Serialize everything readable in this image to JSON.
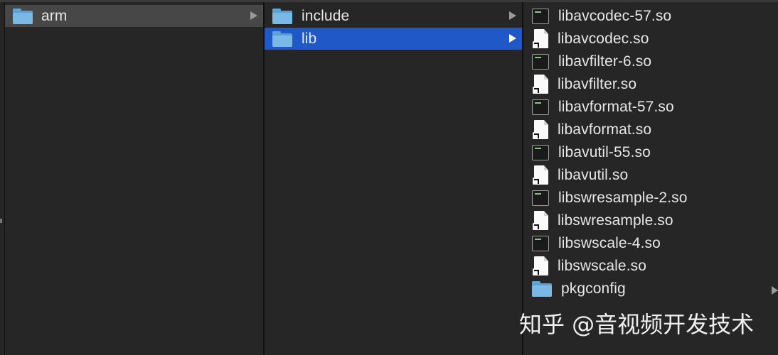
{
  "columns": {
    "col1": {
      "items": [
        {
          "label": "arm",
          "kind": "folder",
          "state": "parent-of-selection",
          "has_children": true
        }
      ]
    },
    "col2": {
      "items": [
        {
          "label": "include",
          "kind": "folder",
          "state": "normal",
          "has_children": true
        },
        {
          "label": "lib",
          "kind": "folder",
          "state": "selected",
          "has_children": true
        }
      ]
    },
    "col3": {
      "items": [
        {
          "label": "libavcodec-57.so",
          "kind": "executable"
        },
        {
          "label": "libavcodec.so",
          "kind": "alias"
        },
        {
          "label": "libavfilter-6.so",
          "kind": "executable"
        },
        {
          "label": "libavfilter.so",
          "kind": "alias"
        },
        {
          "label": "libavformat-57.so",
          "kind": "executable"
        },
        {
          "label": "libavformat.so",
          "kind": "alias"
        },
        {
          "label": "libavutil-55.so",
          "kind": "executable"
        },
        {
          "label": "libavutil.so",
          "kind": "alias"
        },
        {
          "label": "libswresample-2.so",
          "kind": "executable"
        },
        {
          "label": "libswresample.so",
          "kind": "alias"
        },
        {
          "label": "libswscale-4.so",
          "kind": "executable"
        },
        {
          "label": "libswscale.so",
          "kind": "alias"
        },
        {
          "label": "pkgconfig",
          "kind": "folder",
          "has_children": true
        }
      ]
    }
  },
  "icons": {
    "folder": "folder-icon",
    "executable": "executable-file-icon",
    "alias": "alias-document-icon",
    "chevron": "chevron-right-icon"
  },
  "colors": {
    "background": "#262626",
    "selection": "#2158c8",
    "parent_highlight": "#474747",
    "folder": "#7ab8e6"
  },
  "watermark": "知乎 @音视频开发技术"
}
